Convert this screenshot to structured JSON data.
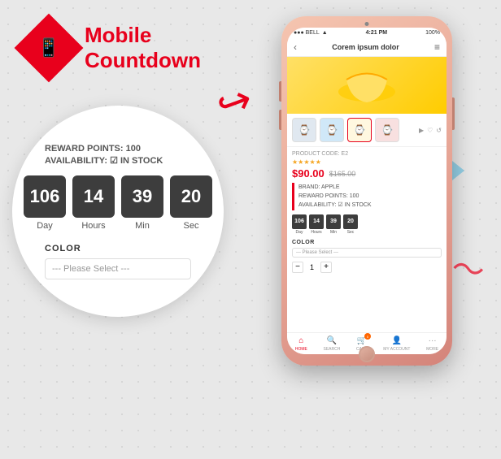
{
  "logo": {
    "icon": "📱",
    "line1": "Mobile",
    "line2": "Countdown"
  },
  "zoom": {
    "reward_label": "REWARD POINTS:",
    "reward_value": "100",
    "availability_label": "AVAILABILITY:",
    "availability_icon": "☑",
    "availability_value": "IN STOCK",
    "countdown": {
      "day": {
        "value": "106",
        "label": "Day"
      },
      "hours": {
        "value": "14",
        "label": "Hours"
      },
      "min": {
        "value": "39",
        "label": "Min"
      },
      "sec": {
        "value": "20",
        "label": "Sec"
      }
    },
    "color_label": "COLOR",
    "color_select": "--- Please Select ---"
  },
  "phone": {
    "status": {
      "left": "●●● BELL",
      "signal": "▲",
      "center": "4:21 PM",
      "battery": "100%"
    },
    "nav": {
      "back": "‹",
      "title": "Corem ipsum dolor",
      "menu": "≡"
    },
    "product": {
      "code": "PRODUCT CODE: E2",
      "stars": "★★★★★",
      "price_new": "$90.00",
      "price_old": "$165.00",
      "brand_label": "BRAND: APPLE",
      "reward_label": "REWARD POINTS: 100",
      "availability_label": "AVAILABILITY:",
      "availability_icon": "☑",
      "availability_value": "IN STOCK"
    },
    "mini_countdown": {
      "day": {
        "value": "106",
        "label": "Day"
      },
      "hours": {
        "value": "14",
        "label": "Hours"
      },
      "min": {
        "value": "39",
        "label": "Min"
      },
      "sec": {
        "value": "20",
        "label": "Sec"
      }
    },
    "color_label": "COLOR",
    "color_select": "--- Please Select ---",
    "qty": "1",
    "bottom_nav": [
      {
        "icon": "⌂",
        "label": "HOME",
        "active": true
      },
      {
        "icon": "🔍",
        "label": "SEARCH",
        "active": false
      },
      {
        "icon": "🛒",
        "label": "CART",
        "active": false,
        "badge": "0"
      },
      {
        "icon": "👤",
        "label": "MY ACCOUNT",
        "active": false
      },
      {
        "icon": "···",
        "label": "MORE",
        "active": false
      }
    ]
  },
  "arrow": "›"
}
